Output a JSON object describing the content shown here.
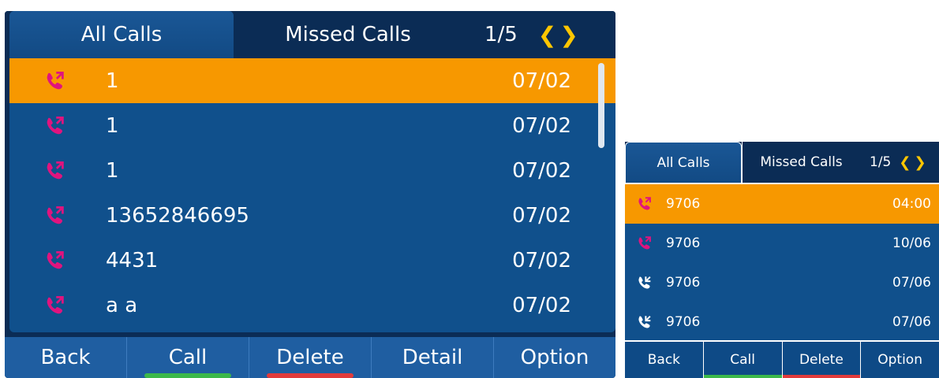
{
  "big": {
    "tabs": {
      "all_calls": "All Calls",
      "missed_calls": "Missed Calls"
    },
    "page_indicator": "1/5",
    "rows": [
      {
        "number": "1",
        "date": "07/02",
        "icon": "outgoing-call-icon"
      },
      {
        "number": "1",
        "date": "07/02",
        "icon": "outgoing-call-icon"
      },
      {
        "number": "1",
        "date": "07/02",
        "icon": "outgoing-call-icon"
      },
      {
        "number": "13652846695",
        "date": "07/02",
        "icon": "outgoing-call-icon"
      },
      {
        "number": "4431",
        "date": "07/02",
        "icon": "outgoing-call-icon"
      },
      {
        "number": "a a",
        "date": "07/02",
        "icon": "outgoing-call-icon"
      }
    ],
    "softkeys": [
      "Back",
      "Call",
      "Delete",
      "Detail",
      "Option"
    ]
  },
  "small": {
    "tabs": {
      "all_calls": "All Calls",
      "missed_calls": "Missed Calls"
    },
    "page_indicator": "1/5",
    "rows": [
      {
        "number": "9706",
        "date": "04:00",
        "icon": "outgoing-call-icon"
      },
      {
        "number": "9706",
        "date": "10/06",
        "icon": "outgoing-call-icon"
      },
      {
        "number": "9706",
        "date": "07/06",
        "icon": "incoming-call-icon"
      },
      {
        "number": "9706",
        "date": "07/06",
        "icon": "incoming-call-icon"
      }
    ],
    "softkeys": [
      "Back",
      "Call",
      "Delete",
      "Option"
    ]
  },
  "colors": {
    "selected_row": "#f79800",
    "list_bg": "#10508c",
    "outgoing_icon": "#e0147e",
    "call_key_bar": "#3cb84a",
    "delete_key_bar": "#e23b3b",
    "page_arrows": "#ffc600"
  }
}
